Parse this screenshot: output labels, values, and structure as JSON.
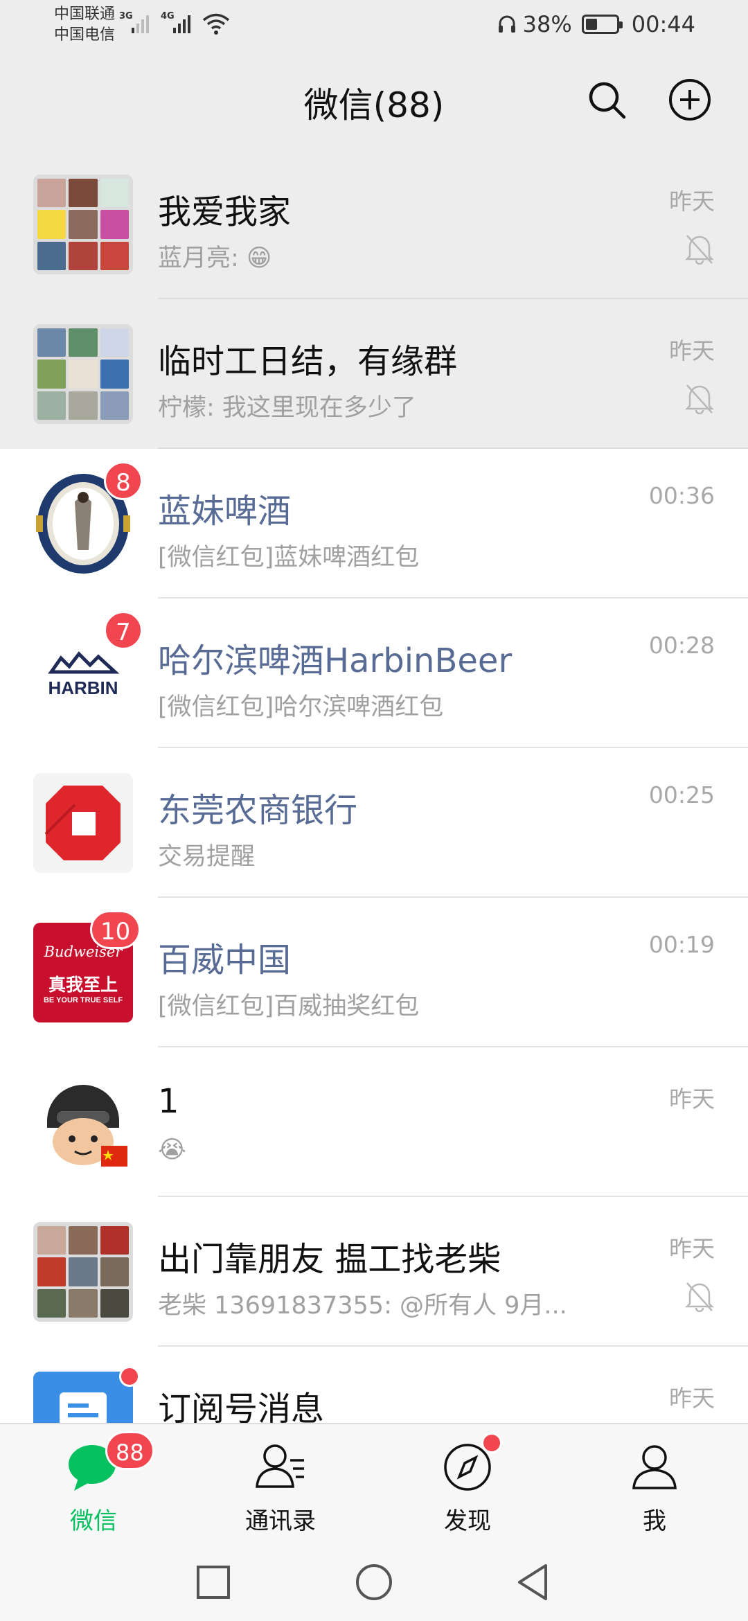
{
  "status": {
    "carrier1": "中国联通",
    "carrier2": "中国电信",
    "net1": "3G",
    "net2": "4G",
    "battery": "38%",
    "battery_level": 0.38,
    "time": "00:44"
  },
  "header": {
    "title": "微信(88)",
    "search_icon": "search-icon",
    "add_icon": "plus-circle-icon"
  },
  "chats": [
    {
      "name": "我爱我家",
      "preview": "蓝月亮: 😁",
      "time": "昨天",
      "muted": true,
      "pinned": true
    },
    {
      "name": "临时工日结，有缘群",
      "preview": "柠檬: 我这里现在多少了",
      "time": "昨天",
      "muted": true,
      "pinned": true
    },
    {
      "name": "蓝妹啤酒",
      "preview": "[微信红包]蓝妹啤酒红包",
      "time": "00:36",
      "badge": "8",
      "official": true
    },
    {
      "name": "哈尔滨啤酒HarbinBeer",
      "preview": "[微信红包]哈尔滨啤酒红包",
      "time": "00:28",
      "badge": "7",
      "official": true,
      "avatar_text": "HARBIN"
    },
    {
      "name": "东莞农商银行",
      "preview": "交易提醒",
      "time": "00:25",
      "official": true
    },
    {
      "name": "百威中国",
      "preview": "[微信红包]百威抽奖红包",
      "time": "00:19",
      "badge": "10",
      "official": true,
      "avatar_text": "Budweiser",
      "avatar_sub": "真我至上",
      "avatar_sub2": "BE YOUR TRUE SELF"
    },
    {
      "name": "1",
      "preview": "😭",
      "time": "昨天"
    },
    {
      "name": "出门靠朋友 揾工找老柴",
      "preview": "老柴 13691837355: @所有人  9月...",
      "time": "昨天",
      "muted": true
    },
    {
      "name": "订阅号消息",
      "preview": "",
      "time": "昨天",
      "dot": true
    }
  ],
  "tabs": [
    {
      "label": "微信",
      "badge": "88",
      "icon": "chat-bubble-icon"
    },
    {
      "label": "通讯录",
      "icon": "contacts-icon"
    },
    {
      "label": "发现",
      "icon": "compass-icon",
      "dot": true
    },
    {
      "label": "我",
      "icon": "person-icon"
    }
  ],
  "nav": [
    "recent-apps-icon",
    "home-icon",
    "back-icon"
  ],
  "colors": {
    "accent_green": "#07c160",
    "badge_red": "#f1464f",
    "official_name_blue": "#576b95",
    "background_gray": "#ededed"
  }
}
